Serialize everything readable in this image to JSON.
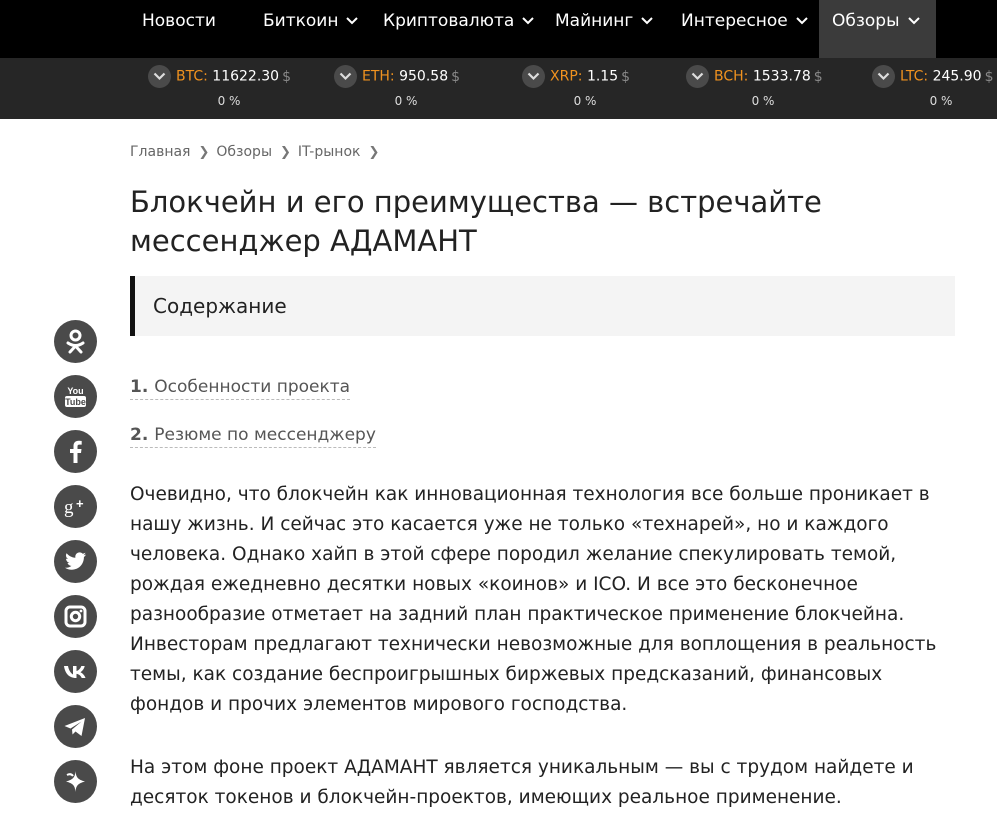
{
  "nav": {
    "items": [
      {
        "label": "Новости",
        "dropdown": false
      },
      {
        "label": "Биткоин",
        "dropdown": true
      },
      {
        "label": "Криптовалюта",
        "dropdown": true
      },
      {
        "label": "Майнинг",
        "dropdown": true
      },
      {
        "label": "Интересное",
        "dropdown": true
      },
      {
        "label": "Обзоры",
        "dropdown": true,
        "active": true
      }
    ]
  },
  "ticker": {
    "coins": [
      {
        "symbol": "BTC:",
        "price": "11622.30",
        "currency": "$",
        "change": "0 %"
      },
      {
        "symbol": "ETH:",
        "price": "950.58",
        "currency": "$",
        "change": "0 %"
      },
      {
        "symbol": "XRP:",
        "price": "1.15",
        "currency": "$",
        "change": "0 %"
      },
      {
        "symbol": "BCH:",
        "price": "1533.78",
        "currency": "$",
        "change": "0 %"
      },
      {
        "symbol": "LTC:",
        "price": "245.90",
        "currency": "$",
        "change": "0 %"
      }
    ]
  },
  "breadcrumb": [
    "Главная",
    "Обзоры",
    "IT-рынок"
  ],
  "article": {
    "title": "Блокчейн и его преимущества — встречайте мессенджер АДАМАНТ",
    "toc_heading": "Содержание",
    "toc": [
      {
        "num": "1.",
        "label": "Особенности проекта"
      },
      {
        "num": "2.",
        "label": "Резюме по мессенджеру"
      }
    ],
    "paragraphs": [
      "Очевидно, что блокчейн как инновационная технология все больше проникает в нашу жизнь. И сейчас это касается уже не только «технарей», но и каждого человека. Однако хайп в этой сфере породил желание спекулировать темой, рождая ежедневно десятки новых «коинов» и ICO. И все это бесконечное разнообразие отметает на задний план практическое применение блокчейна. Инвесторам предлагают технически невозможные для воплощения в реальность темы, как создание беспроигрышных биржевых предсказаний, финансовых фондов и прочих элементов мирового господства.",
      "На этом фоне проект АДАМАНТ является уникальным — вы с трудом найдете и десяток токенов и блокчейн-проектов, имеющих реальное применение."
    ]
  },
  "social": [
    "odnoklassniki-icon",
    "youtube-icon",
    "facebook-icon",
    "google-plus-icon",
    "twitter-icon",
    "instagram-icon",
    "vk-icon",
    "telegram-icon",
    "yandex-zen-icon"
  ],
  "colors": {
    "nav_bg": "#000000",
    "ticker_bg": "#262626",
    "accent": "#f0921f",
    "social_bg": "#4a4a4a"
  }
}
